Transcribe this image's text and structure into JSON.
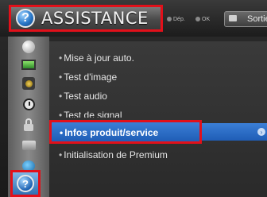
{
  "header": {
    "title": "ASSISTANCE",
    "hint_move": "Dép.",
    "hint_ok": "OK",
    "exit_label": "Sortie"
  },
  "menu": {
    "items": [
      {
        "bullet": "•",
        "label": "Mise à jour auto."
      },
      {
        "bullet": "•",
        "label": "Test d'image"
      },
      {
        "bullet": "•",
        "label": "Test audio"
      },
      {
        "bullet": "•",
        "label": "Test de signal"
      },
      {
        "bullet": "•",
        "label": "Infos produit/service"
      },
      {
        "bullet": "•",
        "label": "Initialisation de Premium"
      }
    ],
    "selected_index": 4
  },
  "sidebar": {
    "icons": [
      "disc-icon",
      "picture-icon",
      "audio-icon",
      "time-icon",
      "lock-icon",
      "option-icon",
      "network-icon",
      "help-icon"
    ],
    "active": "help-icon"
  },
  "colors": {
    "highlight_outline": "#e2101a",
    "selection_blue": "#2a6cc8"
  }
}
